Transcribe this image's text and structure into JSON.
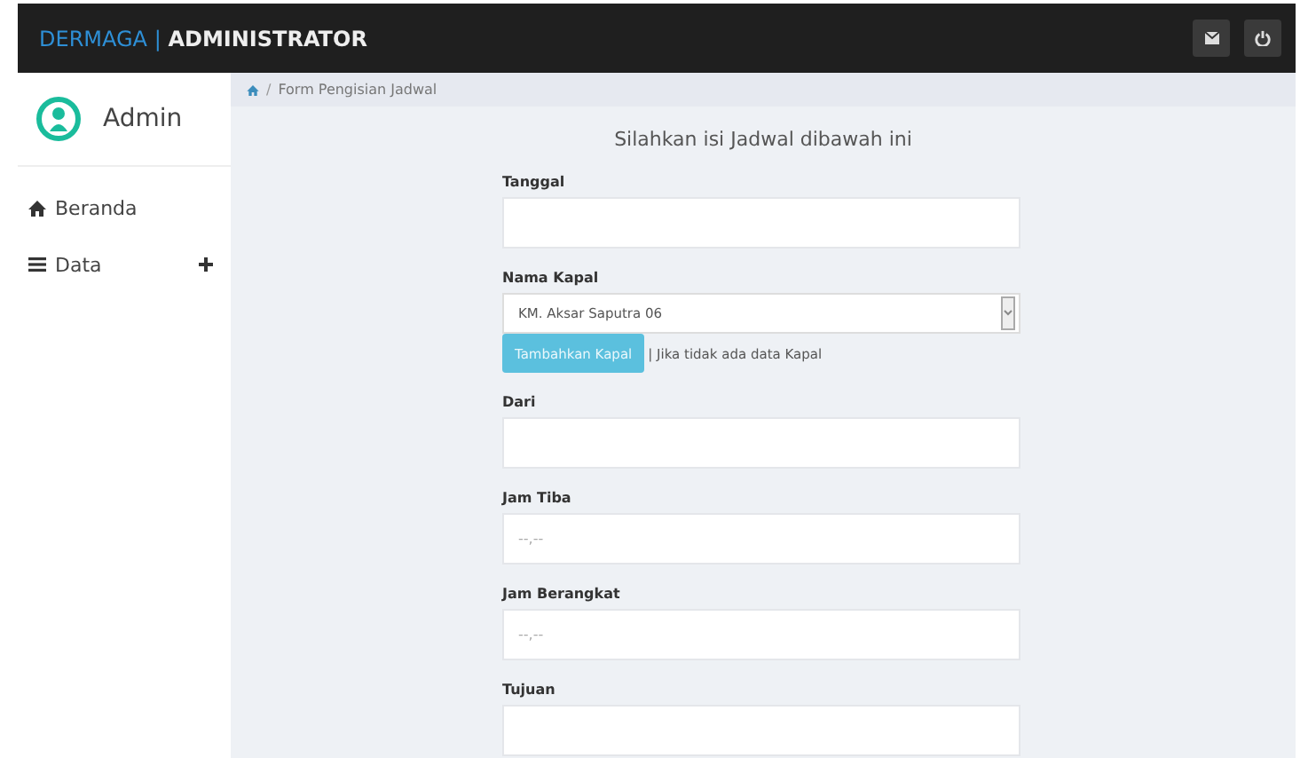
{
  "navbar": {
    "brand_prefix": "DERMAGA",
    "brand_separator": "|",
    "brand_suffix": "ADMINISTRATOR"
  },
  "sidebar": {
    "user": "Admin",
    "items": [
      {
        "label": "Beranda",
        "expandable": false
      },
      {
        "label": "Data",
        "expandable": true
      }
    ]
  },
  "breadcrumb_separator": "/",
  "breadcrumb": "Form Pengisian Jadwal",
  "form": {
    "title": "Silahkan isi Jadwal dibawah ini",
    "fields": [
      {
        "kind": "text",
        "label": "Tanggal"
      },
      {
        "kind": "select",
        "label": "Nama Kapal",
        "value": "KM. Aksar Saputra 06",
        "button": "Tambahkan Kapal",
        "note": "| Jika tidak ada data Kapal"
      },
      {
        "kind": "text",
        "label": "Dari"
      },
      {
        "kind": "text",
        "label": "Jam Tiba",
        "placeholder": "--,--"
      },
      {
        "kind": "text",
        "label": "Jam Berangkat",
        "placeholder": "--,--"
      },
      {
        "kind": "text",
        "label": "Tujuan"
      }
    ]
  }
}
